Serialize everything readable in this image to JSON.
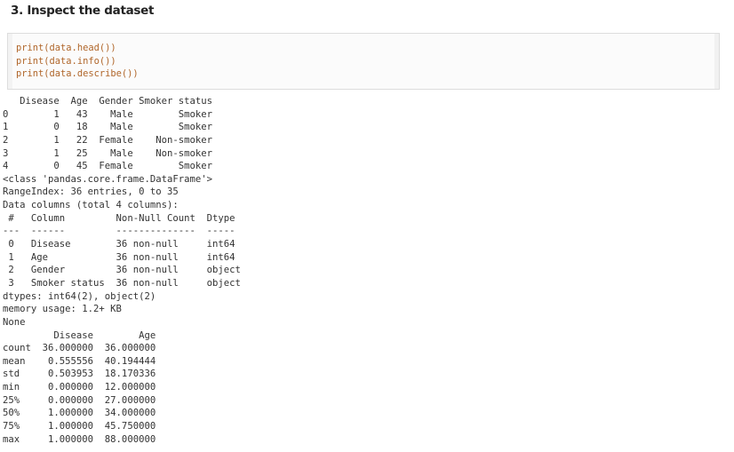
{
  "section": {
    "title": "3. Inspect the dataset"
  },
  "code_cell": {
    "lines": [
      "print(data.head())",
      "print(data.info())",
      "print(data.describe())"
    ]
  },
  "output": {
    "head": {
      "header": "   Disease  Age  Gender Smoker status",
      "columns": [
        "Disease",
        "Age",
        "Gender",
        "Smoker status"
      ],
      "rows": [
        {
          "index": "0",
          "Disease": "1",
          "Age": "43",
          "Gender": "Male",
          "Smoker status": "Smoker",
          "text": "0        1   43    Male        Smoker"
        },
        {
          "index": "1",
          "Disease": "0",
          "Age": "18",
          "Gender": "Male",
          "Smoker status": "Smoker",
          "text": "1        0   18    Male        Smoker"
        },
        {
          "index": "2",
          "Disease": "1",
          "Age": "22",
          "Gender": "Female",
          "Smoker status": "Non-smoker",
          "text": "2        1   22  Female    Non-smoker"
        },
        {
          "index": "3",
          "Disease": "1",
          "Age": "25",
          "Gender": "Male",
          "Smoker status": "Non-smoker",
          "text": "3        1   25    Male    Non-smoker"
        },
        {
          "index": "4",
          "Disease": "0",
          "Age": "45",
          "Gender": "Female",
          "Smoker status": "Smoker",
          "text": "4        0   45  Female        Smoker"
        }
      ]
    },
    "info": {
      "class_line": "<class 'pandas.core.frame.DataFrame'>",
      "range_index": "RangeIndex: 36 entries, 0 to 35",
      "data_columns": "Data columns (total 4 columns):",
      "table_header": " #   Column         Non-Null Count  Dtype ",
      "table_separator": "---  ------         --------------  ----- ",
      "rows": [
        {
          "num": "0",
          "column": "Disease",
          "non_null": "36 non-null",
          "dtype": "int64",
          "text": " 0   Disease        36 non-null     int64 "
        },
        {
          "num": "1",
          "column": "Age",
          "non_null": "36 non-null",
          "dtype": "int64",
          "text": " 1   Age            36 non-null     int64 "
        },
        {
          "num": "2",
          "column": "Gender",
          "non_null": "36 non-null",
          "dtype": "object",
          "text": " 2   Gender         36 non-null     object"
        },
        {
          "num": "3",
          "column": "Smoker status",
          "non_null": "36 non-null",
          "dtype": "object",
          "text": " 3   Smoker status  36 non-null     object"
        }
      ],
      "dtypes": "dtypes: int64(2), object(2)",
      "memory": "memory usage: 1.2+ KB",
      "return_value": "None"
    },
    "describe": {
      "header": "         Disease        Age",
      "columns": [
        "Disease",
        "Age"
      ],
      "rows": [
        {
          "stat": "count",
          "Disease": "36.000000",
          "Age": "36.000000",
          "text": "count  36.000000  36.000000"
        },
        {
          "stat": "mean",
          "Disease": "0.555556",
          "Age": "40.194444",
          "text": "mean    0.555556  40.194444"
        },
        {
          "stat": "std",
          "Disease": "0.503953",
          "Age": "18.170336",
          "text": "std     0.503953  18.170336"
        },
        {
          "stat": "min",
          "Disease": "0.000000",
          "Age": "12.000000",
          "text": "min     0.000000  12.000000"
        },
        {
          "stat": "25%",
          "Disease": "0.000000",
          "Age": "27.000000",
          "text": "25%     0.000000  27.000000"
        },
        {
          "stat": "50%",
          "Disease": "1.000000",
          "Age": "34.000000",
          "text": "50%     1.000000  34.000000"
        },
        {
          "stat": "75%",
          "Disease": "1.000000",
          "Age": "45.750000",
          "text": "75%     1.000000  45.750000"
        },
        {
          "stat": "max",
          "Disease": "1.000000",
          "Age": "88.000000",
          "text": "max     1.000000  88.000000"
        }
      ]
    }
  }
}
